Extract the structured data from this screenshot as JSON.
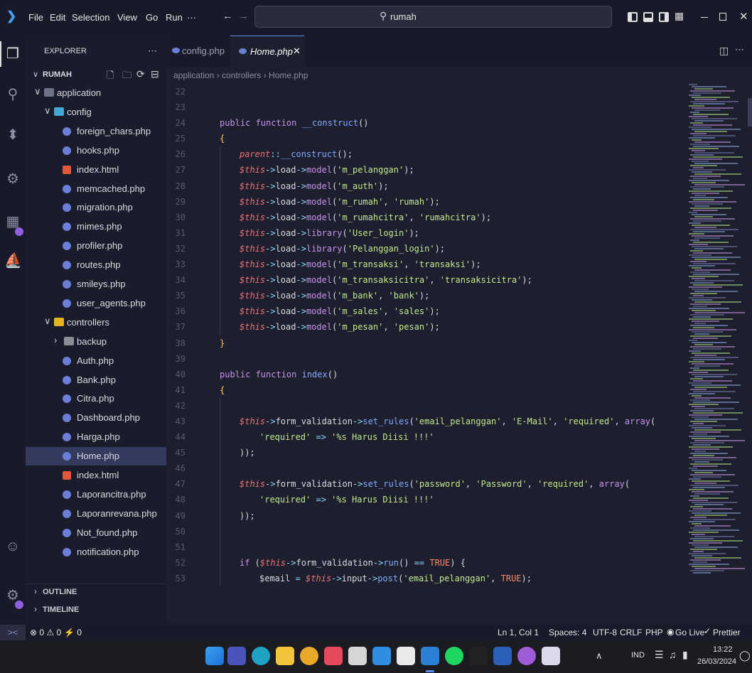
{
  "menu": [
    "File",
    "Edit",
    "Selection",
    "View",
    "Go",
    "Run",
    "···"
  ],
  "search": {
    "text": "rumah"
  },
  "explorer": {
    "title": "EXPLORER",
    "workspace": "RUMAH",
    "outline": "OUTLINE",
    "timeline": "TIMELINE",
    "tree": [
      {
        "label": "application",
        "depth": 1,
        "type": "folder-open",
        "color": "#6f7388"
      },
      {
        "label": "config",
        "depth": 2,
        "type": "folder-open",
        "color": "#44a6d4"
      },
      {
        "label": "foreign_chars.php",
        "depth": 3,
        "type": "php"
      },
      {
        "label": "hooks.php",
        "depth": 3,
        "type": "php"
      },
      {
        "label": "index.html",
        "depth": 3,
        "type": "html"
      },
      {
        "label": "memcached.php",
        "depth": 3,
        "type": "php"
      },
      {
        "label": "migration.php",
        "depth": 3,
        "type": "php"
      },
      {
        "label": "mimes.php",
        "depth": 3,
        "type": "php"
      },
      {
        "label": "profiler.php",
        "depth": 3,
        "type": "php"
      },
      {
        "label": "routes.php",
        "depth": 3,
        "type": "php"
      },
      {
        "label": "smileys.php",
        "depth": 3,
        "type": "php"
      },
      {
        "label": "user_agents.php",
        "depth": 3,
        "type": "php"
      },
      {
        "label": "controllers",
        "depth": 2,
        "type": "folder-open",
        "color": "#e6b422"
      },
      {
        "label": "backup",
        "depth": 3,
        "type": "folder",
        "color": "#8d8d99"
      },
      {
        "label": "Auth.php",
        "depth": 3,
        "type": "php"
      },
      {
        "label": "Bank.php",
        "depth": 3,
        "type": "php"
      },
      {
        "label": "Citra.php",
        "depth": 3,
        "type": "php"
      },
      {
        "label": "Dashboard.php",
        "depth": 3,
        "type": "php"
      },
      {
        "label": "Harga.php",
        "depth": 3,
        "type": "php"
      },
      {
        "label": "Home.php",
        "depth": 3,
        "type": "php",
        "selected": true
      },
      {
        "label": "index.html",
        "depth": 3,
        "type": "html"
      },
      {
        "label": "Laporancitra.php",
        "depth": 3,
        "type": "php"
      },
      {
        "label": "Laporanrevana.php",
        "depth": 3,
        "type": "php"
      },
      {
        "label": "Not_found.php",
        "depth": 3,
        "type": "php"
      },
      {
        "label": "notification.php",
        "depth": 3,
        "type": "php"
      }
    ]
  },
  "tabs": [
    {
      "label": "config.php",
      "active": false
    },
    {
      "label": "Home.php",
      "active": true
    }
  ],
  "breadcrumb": "application › controllers › Home.php",
  "code": [
    {
      "n": "22",
      "t": []
    },
    {
      "n": "23",
      "t": []
    },
    {
      "n": "24",
      "i": 1,
      "t": [
        [
          "k",
          "public function "
        ],
        [
          "f",
          "__construct"
        ],
        [
          "p",
          "()"
        ]
      ]
    },
    {
      "n": "25",
      "i": 1,
      "t": [
        [
          "y",
          "{"
        ]
      ]
    },
    {
      "n": "26",
      "i": 2,
      "t": [
        [
          "it",
          "parent"
        ],
        [
          "o",
          "::"
        ],
        [
          "f",
          "__construct"
        ],
        [
          "p",
          "();"
        ]
      ]
    },
    {
      "n": "27",
      "i": 2,
      "t": [
        [
          "it",
          "$this"
        ],
        [
          "o",
          "->"
        ],
        [
          "p",
          "load"
        ],
        [
          "o",
          "->"
        ],
        [
          "k",
          "model"
        ],
        [
          "p",
          "("
        ],
        [
          "s",
          "'m_pelanggan'"
        ],
        [
          "p",
          ");"
        ]
      ]
    },
    {
      "n": "28",
      "i": 2,
      "t": [
        [
          "it",
          "$this"
        ],
        [
          "o",
          "->"
        ],
        [
          "p",
          "load"
        ],
        [
          "o",
          "->"
        ],
        [
          "k",
          "model"
        ],
        [
          "p",
          "("
        ],
        [
          "s",
          "'m_auth'"
        ],
        [
          "p",
          ");"
        ]
      ]
    },
    {
      "n": "29",
      "i": 2,
      "t": [
        [
          "it",
          "$this"
        ],
        [
          "o",
          "->"
        ],
        [
          "p",
          "load"
        ],
        [
          "o",
          "->"
        ],
        [
          "k",
          "model"
        ],
        [
          "p",
          "("
        ],
        [
          "s",
          "'m_rumah'"
        ],
        [
          "p",
          ", "
        ],
        [
          "s",
          "'rumah'"
        ],
        [
          "p",
          ");"
        ]
      ]
    },
    {
      "n": "30",
      "i": 2,
      "t": [
        [
          "it",
          "$this"
        ],
        [
          "o",
          "->"
        ],
        [
          "p",
          "load"
        ],
        [
          "o",
          "->"
        ],
        [
          "k",
          "model"
        ],
        [
          "p",
          "("
        ],
        [
          "s",
          "'m_rumahcitra'"
        ],
        [
          "p",
          ", "
        ],
        [
          "s",
          "'rumahcitra'"
        ],
        [
          "p",
          ");"
        ]
      ]
    },
    {
      "n": "31",
      "i": 2,
      "t": [
        [
          "it",
          "$this"
        ],
        [
          "o",
          "->"
        ],
        [
          "p",
          "load"
        ],
        [
          "o",
          "->"
        ],
        [
          "k",
          "library"
        ],
        [
          "p",
          "("
        ],
        [
          "s",
          "'User_login'"
        ],
        [
          "p",
          ");"
        ]
      ]
    },
    {
      "n": "32",
      "i": 2,
      "t": [
        [
          "it",
          "$this"
        ],
        [
          "o",
          "->"
        ],
        [
          "p",
          "load"
        ],
        [
          "o",
          "->"
        ],
        [
          "k",
          "library"
        ],
        [
          "p",
          "("
        ],
        [
          "s",
          "'Pelanggan_login'"
        ],
        [
          "p",
          ");"
        ]
      ]
    },
    {
      "n": "33",
      "i": 2,
      "t": [
        [
          "it",
          "$this"
        ],
        [
          "o",
          "->"
        ],
        [
          "p",
          "load"
        ],
        [
          "o",
          "->"
        ],
        [
          "k",
          "model"
        ],
        [
          "p",
          "("
        ],
        [
          "s",
          "'m_transaksi'"
        ],
        [
          "p",
          ", "
        ],
        [
          "s",
          "'transaksi'"
        ],
        [
          "p",
          ");"
        ]
      ]
    },
    {
      "n": "34",
      "i": 2,
      "t": [
        [
          "it",
          "$this"
        ],
        [
          "o",
          "->"
        ],
        [
          "p",
          "load"
        ],
        [
          "o",
          "->"
        ],
        [
          "k",
          "model"
        ],
        [
          "p",
          "("
        ],
        [
          "s",
          "'m_transaksicitra'"
        ],
        [
          "p",
          ", "
        ],
        [
          "s",
          "'transaksicitra'"
        ],
        [
          "p",
          ");"
        ]
      ]
    },
    {
      "n": "35",
      "i": 2,
      "t": [
        [
          "it",
          "$this"
        ],
        [
          "o",
          "->"
        ],
        [
          "p",
          "load"
        ],
        [
          "o",
          "->"
        ],
        [
          "k",
          "model"
        ],
        [
          "p",
          "("
        ],
        [
          "s",
          "'m_bank'"
        ],
        [
          "p",
          ", "
        ],
        [
          "s",
          "'bank'"
        ],
        [
          "p",
          ");"
        ]
      ]
    },
    {
      "n": "36",
      "i": 2,
      "t": [
        [
          "it",
          "$this"
        ],
        [
          "o",
          "->"
        ],
        [
          "p",
          "load"
        ],
        [
          "o",
          "->"
        ],
        [
          "k",
          "model"
        ],
        [
          "p",
          "("
        ],
        [
          "s",
          "'m_sales'"
        ],
        [
          "p",
          ", "
        ],
        [
          "s",
          "'sales'"
        ],
        [
          "p",
          ");"
        ]
      ]
    },
    {
      "n": "37",
      "i": 2,
      "t": [
        [
          "it",
          "$this"
        ],
        [
          "o",
          "->"
        ],
        [
          "p",
          "load"
        ],
        [
          "o",
          "->"
        ],
        [
          "k",
          "model"
        ],
        [
          "p",
          "("
        ],
        [
          "s",
          "'m_pesan'"
        ],
        [
          "p",
          ", "
        ],
        [
          "s",
          "'pesan'"
        ],
        [
          "p",
          ");"
        ]
      ]
    },
    {
      "n": "38",
      "i": 1,
      "t": [
        [
          "y",
          "}"
        ]
      ]
    },
    {
      "n": "39",
      "t": []
    },
    {
      "n": "40",
      "i": 1,
      "t": [
        [
          "k",
          "public function "
        ],
        [
          "f",
          "index"
        ],
        [
          "p",
          "()"
        ]
      ]
    },
    {
      "n": "41",
      "i": 1,
      "t": [
        [
          "y",
          "{"
        ]
      ]
    },
    {
      "n": "42",
      "t": []
    },
    {
      "n": "43",
      "i": 2,
      "t": [
        [
          "it",
          "$this"
        ],
        [
          "o",
          "->"
        ],
        [
          "p",
          "form_validation"
        ],
        [
          "o",
          "->"
        ],
        [
          "f",
          "set_rules"
        ],
        [
          "p",
          "("
        ],
        [
          "s",
          "'email_pelanggan'"
        ],
        [
          "p",
          ", "
        ],
        [
          "s",
          "'E-Mail'"
        ],
        [
          "p",
          ", "
        ],
        [
          "s",
          "'required'"
        ],
        [
          "p",
          ", "
        ],
        [
          "k",
          "array"
        ],
        [
          "p",
          "("
        ]
      ]
    },
    {
      "n": "44",
      "i": 3,
      "t": [
        [
          "s",
          "'required'"
        ],
        [
          "p",
          " "
        ],
        [
          "o",
          "=>"
        ],
        [
          "p",
          " "
        ],
        [
          "s",
          "'%s Harus Diisi !!!'"
        ]
      ]
    },
    {
      "n": "45",
      "i": 2,
      "t": [
        [
          "p",
          "));"
        ]
      ]
    },
    {
      "n": "46",
      "t": []
    },
    {
      "n": "47",
      "i": 2,
      "t": [
        [
          "it",
          "$this"
        ],
        [
          "o",
          "->"
        ],
        [
          "p",
          "form_validation"
        ],
        [
          "o",
          "->"
        ],
        [
          "f",
          "set_rules"
        ],
        [
          "p",
          "("
        ],
        [
          "s",
          "'password'"
        ],
        [
          "p",
          ", "
        ],
        [
          "s",
          "'Password'"
        ],
        [
          "p",
          ", "
        ],
        [
          "s",
          "'required'"
        ],
        [
          "p",
          ", "
        ],
        [
          "k",
          "array"
        ],
        [
          "p",
          "("
        ]
      ]
    },
    {
      "n": "48",
      "i": 3,
      "t": [
        [
          "s",
          "'required'"
        ],
        [
          "p",
          " "
        ],
        [
          "o",
          "=>"
        ],
        [
          "p",
          " "
        ],
        [
          "s",
          "'%s Harus Diisi !!!'"
        ]
      ]
    },
    {
      "n": "49",
      "i": 2,
      "t": [
        [
          "p",
          "));"
        ]
      ]
    },
    {
      "n": "50",
      "t": []
    },
    {
      "n": "51",
      "t": []
    },
    {
      "n": "52",
      "i": 2,
      "t": [
        [
          "k",
          "if"
        ],
        [
          "p",
          " ("
        ],
        [
          "it",
          "$this"
        ],
        [
          "o",
          "->"
        ],
        [
          "p",
          "form_validation"
        ],
        [
          "o",
          "->"
        ],
        [
          "f",
          "run"
        ],
        [
          "p",
          "() "
        ],
        [
          "o",
          "=="
        ],
        [
          "p",
          " "
        ],
        [
          "c",
          "TRUE"
        ],
        [
          "p",
          ") {"
        ]
      ]
    },
    {
      "n": "53",
      "i": 3,
      "t": [
        [
          "p",
          "$email "
        ],
        [
          "o",
          "="
        ],
        [
          "p",
          " "
        ],
        [
          "it",
          "$this"
        ],
        [
          "o",
          "->"
        ],
        [
          "p",
          "input"
        ],
        [
          "o",
          "->"
        ],
        [
          "f",
          "post"
        ],
        [
          "p",
          "("
        ],
        [
          "s",
          "'email_pelanggan'"
        ],
        [
          "p",
          ", "
        ],
        [
          "c",
          "TRUE"
        ],
        [
          "p",
          ");"
        ]
      ]
    }
  ],
  "status": {
    "left": "⊗ 0 ⚠ 0",
    "ports": "⚡ 0",
    "position": "Ln 1, Col 1",
    "spaces": "Spaces: 4",
    "encoding": "UTF-8",
    "eol": "CRLF",
    "language": "PHP",
    "golive": "Go Live",
    "prettier": "Prettier"
  },
  "taskbar": {
    "lang": "IND",
    "time": "13:22",
    "date": "26/03/2024"
  },
  "colors": {
    "accent": "#5a8dee",
    "selected": "#343a5e"
  }
}
